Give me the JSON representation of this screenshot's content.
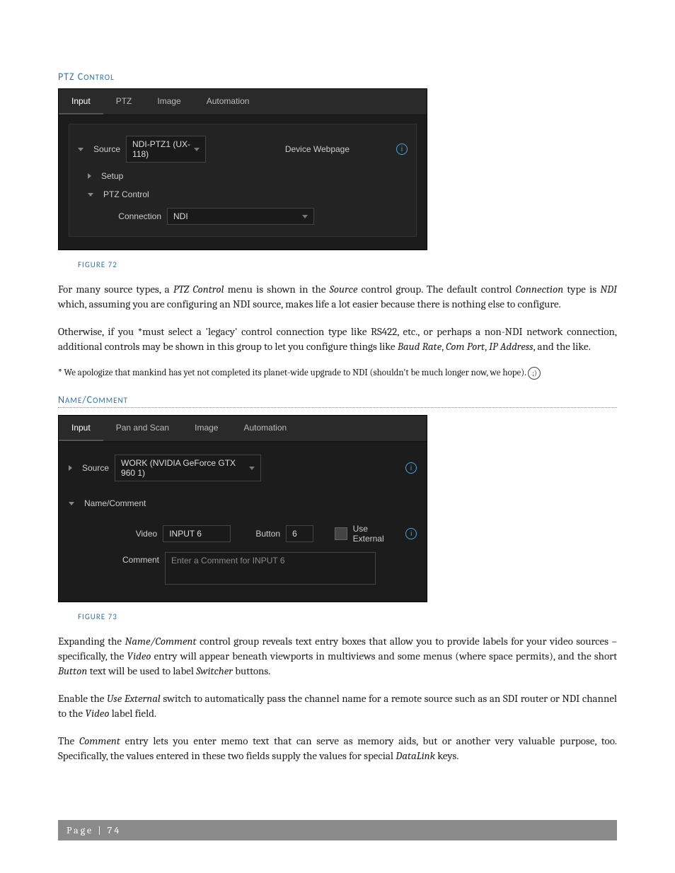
{
  "section1_heading": "PTZ Control",
  "fig1": {
    "tabs": [
      "Input",
      "PTZ",
      "Image",
      "Automation"
    ],
    "source_label": "Source",
    "source_value": "NDI-PTZ1 (UX-118)",
    "device_webpage": "Device Webpage",
    "setup_label": "Setup",
    "ptz_control_label": "PTZ Control",
    "connection_label": "Connection",
    "connection_value": "NDI"
  },
  "fig1_caption": "FIGURE 72",
  "para1_a": "For many source types, a ",
  "para1_b": "PTZ Control",
  "para1_c": " menu is shown in the ",
  "para1_d": "Source",
  "para1_e": " control group.  The default control ",
  "para1_f": "Connection",
  "para1_g": " type is ",
  "para1_h": "NDI",
  "para1_i": " which, assuming you are configuring an NDI source, makes life a lot easier because there is nothing else to configure.",
  "para2_a": "Otherwise, if you *must select a 'legacy' control connection type like RS422, etc., or perhaps a non-NDI network connection, additional controls may be shown in this group to let you configure things like ",
  "para2_b": "Baud Rate",
  "para2_c": ", ",
  "para2_d": "Com Port",
  "para2_e": ", ",
  "para2_f": "IP Address",
  "para2_g": ", and the like.",
  "footnote": "* We apologize that mankind has yet not completed its planet-wide upgrade to NDI (shouldn't be much longer now, we hope).",
  "section2_heading": "Name/Comment",
  "fig2": {
    "tabs": [
      "Input",
      "Pan and Scan",
      "Image",
      "Automation"
    ],
    "source_label": "Source",
    "source_value": "WORK (NVIDIA GeForce GTX 960 1)",
    "namecomment_label": "Name/Comment",
    "video_label": "Video",
    "video_value": "INPUT 6",
    "button_label": "Button",
    "button_value": "6",
    "use_external_label": "Use External",
    "comment_label": "Comment",
    "comment_placeholder": "Enter a Comment for INPUT 6"
  },
  "fig2_caption": "FIGURE 73",
  "para3_a": "Expanding the ",
  "para3_b": "Name/Comment",
  "para3_c": " control group reveals text entry boxes that allow you to provide labels for your video sources – specifically, the ",
  "para3_d": "Video",
  "para3_e": " entry will appear beneath viewports in multiviews and some menus (where space permits), and the short ",
  "para3_f": "Button",
  "para3_g": " text will be used to label ",
  "para3_h": "Switcher",
  "para3_i": " buttons.",
  "para4_a": "Enable the ",
  "para4_b": "Use External",
  "para4_c": " switch to automatically pass the channel name for a remote source such as an SDI router or NDI channel to the ",
  "para4_d": "Video",
  "para4_e": " label field.",
  "para5_a": "The ",
  "para5_b": "Comment",
  "para5_c": " entry lets you enter memo text that can serve as memory aids, but or another very valuable purpose, too.  Specifically, the values entered in these two fields supply the values for special ",
  "para5_d": "DataLink",
  "para5_e": " keys.",
  "footer": "Page | 74"
}
